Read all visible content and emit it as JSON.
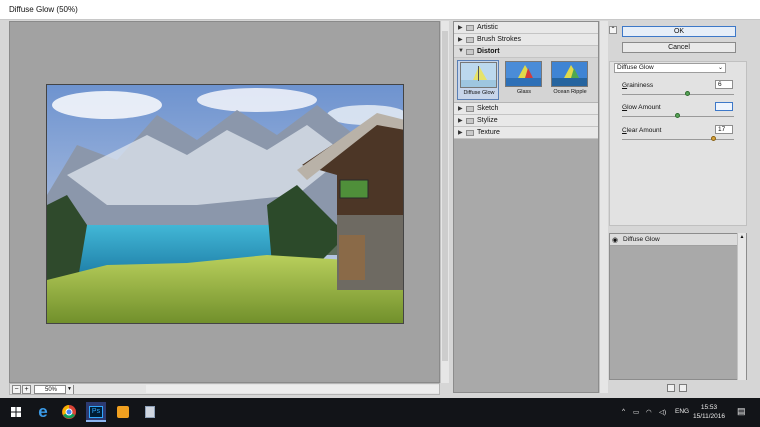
{
  "window": {
    "title": "Diffuse Glow (50%)"
  },
  "preview": {
    "zoom": "50%"
  },
  "gallery": {
    "categories_top": [
      {
        "label": "Artistic"
      },
      {
        "label": "Brush Strokes"
      }
    ],
    "open_category": {
      "label": "Distort"
    },
    "filters": [
      {
        "label": "Diffuse Glow",
        "selected": true
      },
      {
        "label": "Glass",
        "selected": false
      },
      {
        "label": "Ocean Ripple",
        "selected": false
      }
    ],
    "categories_bottom": [
      {
        "label": "Sketch"
      },
      {
        "label": "Stylize"
      },
      {
        "label": "Texture"
      }
    ]
  },
  "actions": {
    "ok": "OK",
    "cancel": "Cancel"
  },
  "settings": {
    "filter_select": "Diffuse Glow",
    "params": [
      {
        "label_key": "G",
        "label_rest": "raininess",
        "value": "6",
        "fraction": 0.6
      },
      {
        "label_key": "G",
        "label_rest": "low Amount",
        "value": "",
        "fraction": 0.5
      },
      {
        "label_key": "C",
        "label_rest": "lear Amount",
        "value": "17",
        "fraction": 0.85
      }
    ]
  },
  "layers": {
    "items": [
      {
        "label": "Diffuse Glow"
      }
    ]
  },
  "taskbar": {
    "lang": "ENG",
    "time": "15:53",
    "date": "15/11/2016"
  },
  "colors": {
    "accent": "#3d78c8",
    "taskbar": "#121418",
    "preview_bg": "#a2a2a2"
  }
}
